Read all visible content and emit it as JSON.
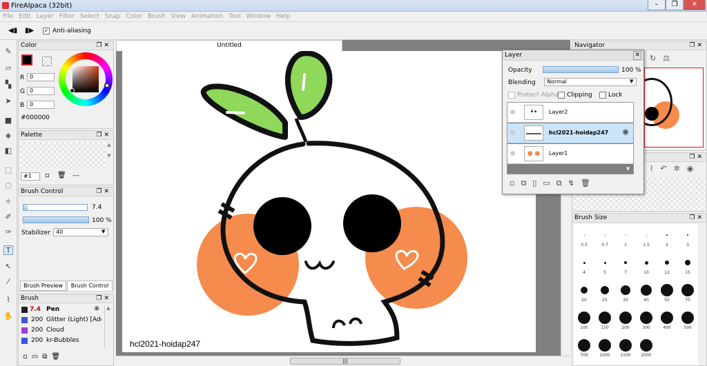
{
  "window": {
    "title": "FireAlpaca (32bit)",
    "min": "–",
    "max": "❐",
    "close": "✕"
  },
  "menu": [
    "File",
    "Edit",
    "Layer",
    "Filter",
    "Select",
    "Snap",
    "Color",
    "Brush",
    "View",
    "Animation",
    "Tool",
    "Window",
    "Help"
  ],
  "toolbar": {
    "anti_aliasing": "Anti-aliasing",
    "anti_aliasing_checked": true
  },
  "color_panel": {
    "title": "Color",
    "r_label": "R",
    "g_label": "G",
    "b_label": "B",
    "r": "0",
    "g": "0",
    "b": "0",
    "hex": "#000000",
    "fg": "#000000"
  },
  "palette_panel": {
    "title": "Palette",
    "select_value": "#1",
    "dash": "---"
  },
  "brush_control": {
    "title": "Brush Control",
    "size": "7.4",
    "size_fraction": 0.07,
    "opacity": "100 %",
    "opacity_fraction": 1.0,
    "stabilizer_label": "Stabilizer",
    "stabilizer_value": "40",
    "tab_preview": "Brush Preview",
    "tab_control": "Brush Control"
  },
  "brush_panel": {
    "title": "Brush",
    "items": [
      {
        "size": "7.4",
        "name": "Pen",
        "color": "#202020",
        "selected": true
      },
      {
        "size": "200",
        "name": "Glitter (Light) [Add]",
        "color": "#3a55d8",
        "selected": false
      },
      {
        "size": "200",
        "name": "Cloud",
        "color": "#9b3fd6",
        "selected": false
      },
      {
        "size": "200",
        "name": "kr-Bubbles",
        "color": "#3a55d8",
        "selected": false
      }
    ]
  },
  "document": {
    "tab_title": "Untitled",
    "signature": "hcl2021-hoidap247"
  },
  "layer_panel": {
    "title": "Layer",
    "opacity_label": "Opacity",
    "opacity_value": "100 %",
    "opacity_fraction": 1.0,
    "blending_label": "Blending",
    "blending_value": "Normal",
    "protect_alpha": "Protect Alpha",
    "clipping": "Clipping",
    "lock": "Lock",
    "layers": [
      {
        "name": "Layer2",
        "selected": false
      },
      {
        "name": "hcl2021-hoidap247",
        "selected": true
      },
      {
        "name": "Layer1",
        "selected": false
      }
    ]
  },
  "navigator_panel": {
    "title": "Navigator"
  },
  "brush_size_panel": {
    "title": "Brush Size",
    "sizes": [
      "0.5",
      "0.7",
      "1",
      "1.5",
      "2",
      "3",
      "4",
      "5",
      "7",
      "10",
      "12",
      "15",
      "20",
      "25",
      "30",
      "40",
      "50",
      "70",
      "100",
      "150",
      "200",
      "300",
      "400",
      "500",
      "700",
      "1000",
      "1500",
      "2000"
    ]
  }
}
